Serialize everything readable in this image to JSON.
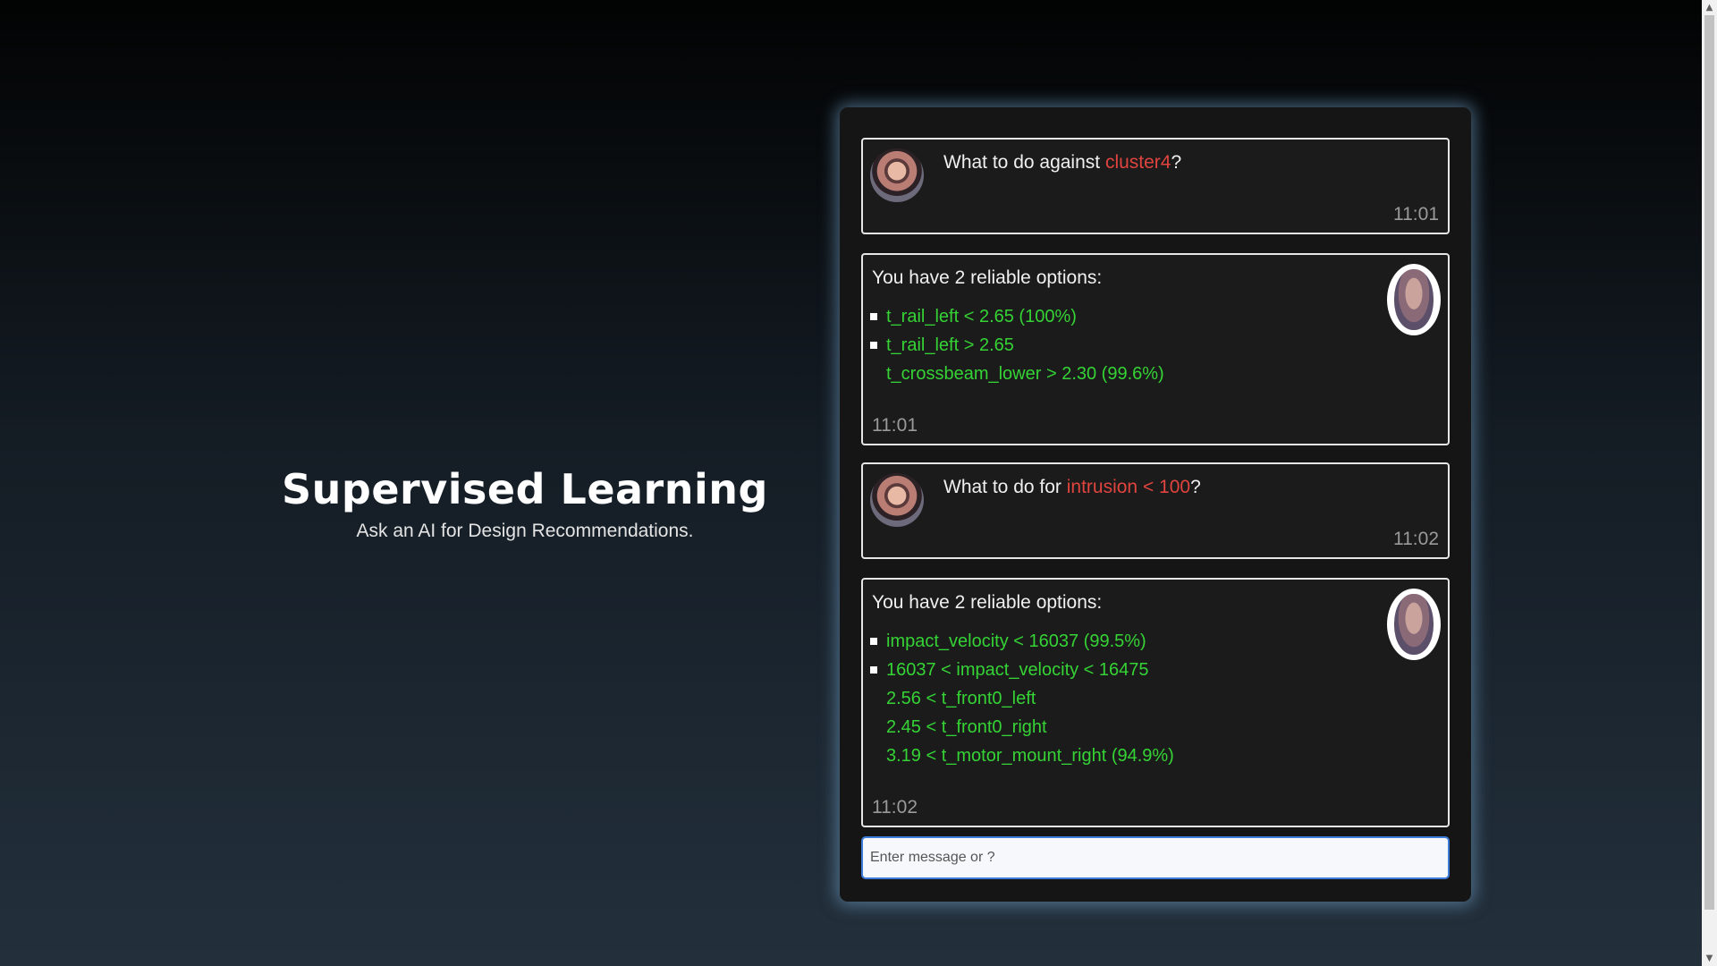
{
  "hero": {
    "title": "Supervised Learning",
    "subtitle": "Ask an AI for Design Recommendations."
  },
  "chat": {
    "messages": [
      {
        "sender": "user",
        "text_before": "What to do against ",
        "highlight": "cluster4",
        "text_after": "?",
        "time": "11:01"
      },
      {
        "sender": "bot",
        "intro": "You have 2 reliable options:",
        "options": [
          {
            "lines": [
              "t_rail_left < 2.65 (100%)"
            ]
          },
          {
            "lines": [
              "t_rail_left > 2.65",
              "t_crossbeam_lower > 2.30 (99.6%)"
            ]
          }
        ],
        "time": "11:01"
      },
      {
        "sender": "user",
        "text_before": "What to do for ",
        "highlight": "intrusion < 100",
        "text_after": "?",
        "time": "11:02"
      },
      {
        "sender": "bot",
        "intro": "You have 2 reliable options:",
        "options": [
          {
            "lines": [
              "impact_velocity < 16037 (99.5%)"
            ]
          },
          {
            "lines": [
              "16037 < impact_velocity < 16475",
              "2.56 < t_front0_left",
              "2.45 < t_front0_right",
              "3.19 < t_motor_mount_right (94.9%)"
            ]
          }
        ],
        "time": "11:02"
      }
    ],
    "input": {
      "placeholder": "Enter message or ?",
      "value": ""
    }
  },
  "colors": {
    "highlight": "#e0443e",
    "option_text": "#35d335",
    "panel_glow": "#78aad2"
  },
  "icons": {
    "user_avatar": "user-avatar-photo",
    "bot_avatar": "bot-avatar-face",
    "scroll_up": "▲",
    "scroll_down": "▼"
  }
}
